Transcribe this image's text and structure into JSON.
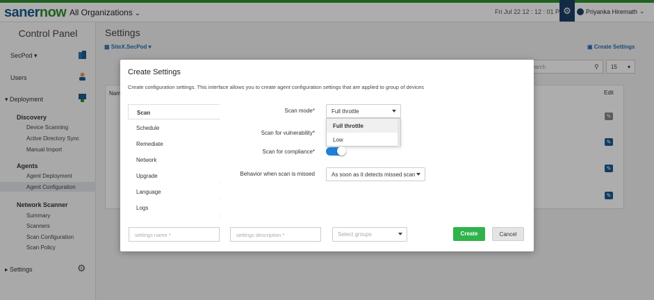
{
  "topbar": {
    "logo_a": "saner",
    "logo_b": "now",
    "org": "All Organizations",
    "datetime": "Fri Jul 22  12 : 12 : 01 PM",
    "user": "Priyanka Hiremath",
    "accent": "#2f8f2f"
  },
  "sidebar": {
    "title": "Control Panel",
    "secpod": "SecPod",
    "users": "Users",
    "deployment": "Deployment",
    "discovery": "Discovery",
    "discovery_items": [
      "Device Scanning",
      "Active Directory Sync",
      "Manual Import"
    ],
    "agents": "Agents",
    "agents_items": [
      "Agent Deployment",
      "Agent Configuration"
    ],
    "network_scanner": "Network Scanner",
    "network_items": [
      "Summary",
      "Scanners",
      "Scan Configuration",
      "Scan Policy"
    ],
    "settings": "Settings"
  },
  "main": {
    "title": "Settings",
    "site": "SiteX.SecPod",
    "create_link": "Create Settings",
    "search_placeholder": "earch",
    "per_page": "15",
    "col_name": "Nam",
    "col_edit": "Edit"
  },
  "modal": {
    "title": "Create Settings",
    "description": "Create configuration settings. This interface allows you to create agent configuration settings that are applied to group of devices",
    "tabs": [
      "Scan",
      "Schedule",
      "Remediate",
      "Network",
      "Upgrade",
      "Language",
      "Logs"
    ],
    "scan_mode_label": "Scan mode*",
    "scan_mode_value": "Full throttle",
    "scan_mode_options": [
      "Full throttle",
      "Low"
    ],
    "scan_vuln_label": "Scan for vulnerability*",
    "scan_compliance_label": "Scan for compliance*",
    "scan_compliance_on": true,
    "missed_label": "Behavior when scan is missed",
    "missed_value": "As soon as it detects missed scan",
    "name_placeholder": "settings name *",
    "desc_placeholder": "settings description *",
    "groups_placeholder": "Select groups",
    "create_label": "Create",
    "cancel_label": "Cancel"
  }
}
